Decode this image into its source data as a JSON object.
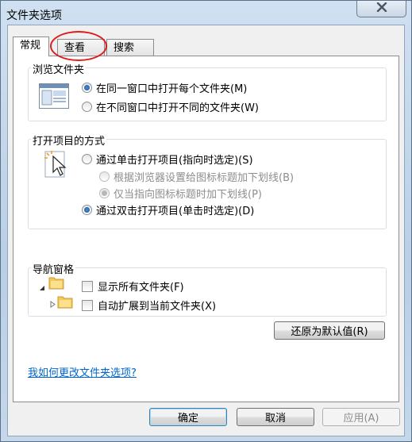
{
  "window": {
    "title": "文件夹选项"
  },
  "tabs": [
    {
      "label": "常规"
    },
    {
      "label": "查看"
    },
    {
      "label": "搜索"
    }
  ],
  "browse": {
    "title": "浏览文件夹",
    "options": [
      {
        "label": "在同一窗口中打开每个文件夹(M)",
        "selected": true
      },
      {
        "label": "在不同窗口中打开不同的文件夹(W)",
        "selected": false
      }
    ]
  },
  "click": {
    "title": "打开项目的方式",
    "single": "通过单击打开项目(指向时选定)(S)",
    "sub": [
      {
        "label": "根据浏览器设置给图标标题加下划线(B)"
      },
      {
        "label": "仅当指向图标标题时加下划线(P)"
      }
    ],
    "double": "通过双击打开项目(单击时选定)(D)"
  },
  "nav": {
    "title": "导航窗格",
    "items": [
      {
        "label": "显示所有文件夹(F)"
      },
      {
        "label": "自动扩展到当前文件夹(X)"
      }
    ]
  },
  "buttons": {
    "restore": "还原为默认值(R)",
    "ok": "确定",
    "cancel": "取消",
    "apply": "应用(A)"
  },
  "help_link": "我如何更改文件夹选项?"
}
